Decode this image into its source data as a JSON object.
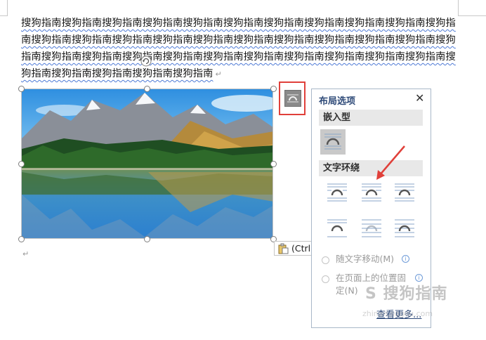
{
  "document": {
    "paragraph_text": "搜狗指南搜狗指南搜狗指南搜狗指南搜狗指南搜狗指南搜狗指南搜狗指南搜狗指南搜狗指南搜狗指南搜狗指南搜狗指南搜狗指南搜狗指南搜狗指南搜狗指南搜狗指南搜狗指南搜狗指南搜狗指南搜狗指南搜狗指南搜狗指南搜狗指南搜狗指南搜狗指南搜狗指南搜狗指南搜狗指南搜狗指南搜狗指南搜狗指南搜狗指南搜狗指南搜狗指南搜狗指南",
    "paragraph_mark": "↵",
    "empty_paragraph_mark": "↵",
    "paste_options_label": "(Ctrl)"
  },
  "layout_panel": {
    "title": "布局选项",
    "close_glyph": "✕",
    "inline_section": "嵌入型",
    "wrap_section": "文字环绕",
    "move_with_text": "随文字移动(M)",
    "fix_position": "在页面上的位置固定(N)",
    "see_more": "查看更多..."
  },
  "watermark": {
    "text": "S 搜狗指南",
    "sub": "zhinan.sogou.com"
  },
  "colors": {
    "highlight": "#e0403a",
    "panel_border": "#a9b8c8",
    "panel_title": "#2e4a78",
    "spell_underline": "#4e7ad6"
  }
}
